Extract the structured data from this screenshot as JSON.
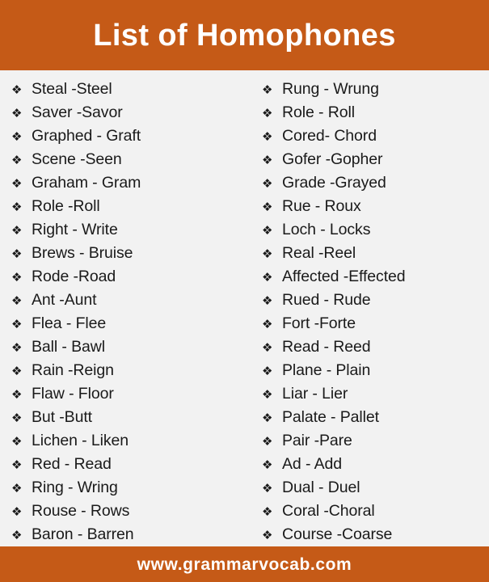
{
  "header": {
    "title": "List of Homophones",
    "background_color": "#c55a17",
    "text_color": "#ffffff"
  },
  "page": {
    "background_color": "#f2f2f2",
    "text_color": "#1a1a1a",
    "bullet_glyph": "❖",
    "bullet_icon_name": "four-diamond-bullet-icon"
  },
  "columns": {
    "left": [
      {
        "text": "Steal -Steel"
      },
      {
        "text": "Saver -Savor"
      },
      {
        "text": "Graphed - Graft"
      },
      {
        "text": "Scene -Seen"
      },
      {
        "text": "Graham - Gram"
      },
      {
        "text": "Role -Roll"
      },
      {
        "text": "Right - Write"
      },
      {
        "text": "Brews - Bruise"
      },
      {
        "text": "Rode -Road"
      },
      {
        "text": "Ant -Aunt"
      },
      {
        "text": "Flea - Flee"
      },
      {
        "text": "Ball - Bawl"
      },
      {
        "text": "Rain -Reign"
      },
      {
        "text": "Flaw - Floor"
      },
      {
        "text": "But -Butt"
      },
      {
        "text": "Lichen - Liken"
      },
      {
        "text": "Red - Read"
      },
      {
        "text": "Ring - Wring"
      },
      {
        "text": "Rouse - Rows"
      },
      {
        "text": "Baron - Barren"
      }
    ],
    "right": [
      {
        "text": "Rung - Wrung"
      },
      {
        "text": "Role - Roll"
      },
      {
        "text": "Cored- Chord"
      },
      {
        "text": "Gofer -Gopher"
      },
      {
        "text": "Grade -Grayed"
      },
      {
        "text": "Rue - Roux"
      },
      {
        "text": "Loch - Locks"
      },
      {
        "text": "Real -Reel"
      },
      {
        "text": "Affected -Effected"
      },
      {
        "text": "Rued - Rude"
      },
      {
        "text": "Fort -Forte"
      },
      {
        "text": "Read - Reed"
      },
      {
        "text": "Plane - Plain"
      },
      {
        "text": "Liar - Lier"
      },
      {
        "text": "Palate - Pallet"
      },
      {
        "text": "Pair -Pare"
      },
      {
        "text": "Ad - Add"
      },
      {
        "text": "Dual - Duel"
      },
      {
        "text": "Coral -Choral"
      },
      {
        "text": "Course -Coarse"
      }
    ]
  },
  "footer": {
    "website": "www.grammarvocab.com",
    "background_color": "#c55a17",
    "text_color": "#ffffff"
  }
}
